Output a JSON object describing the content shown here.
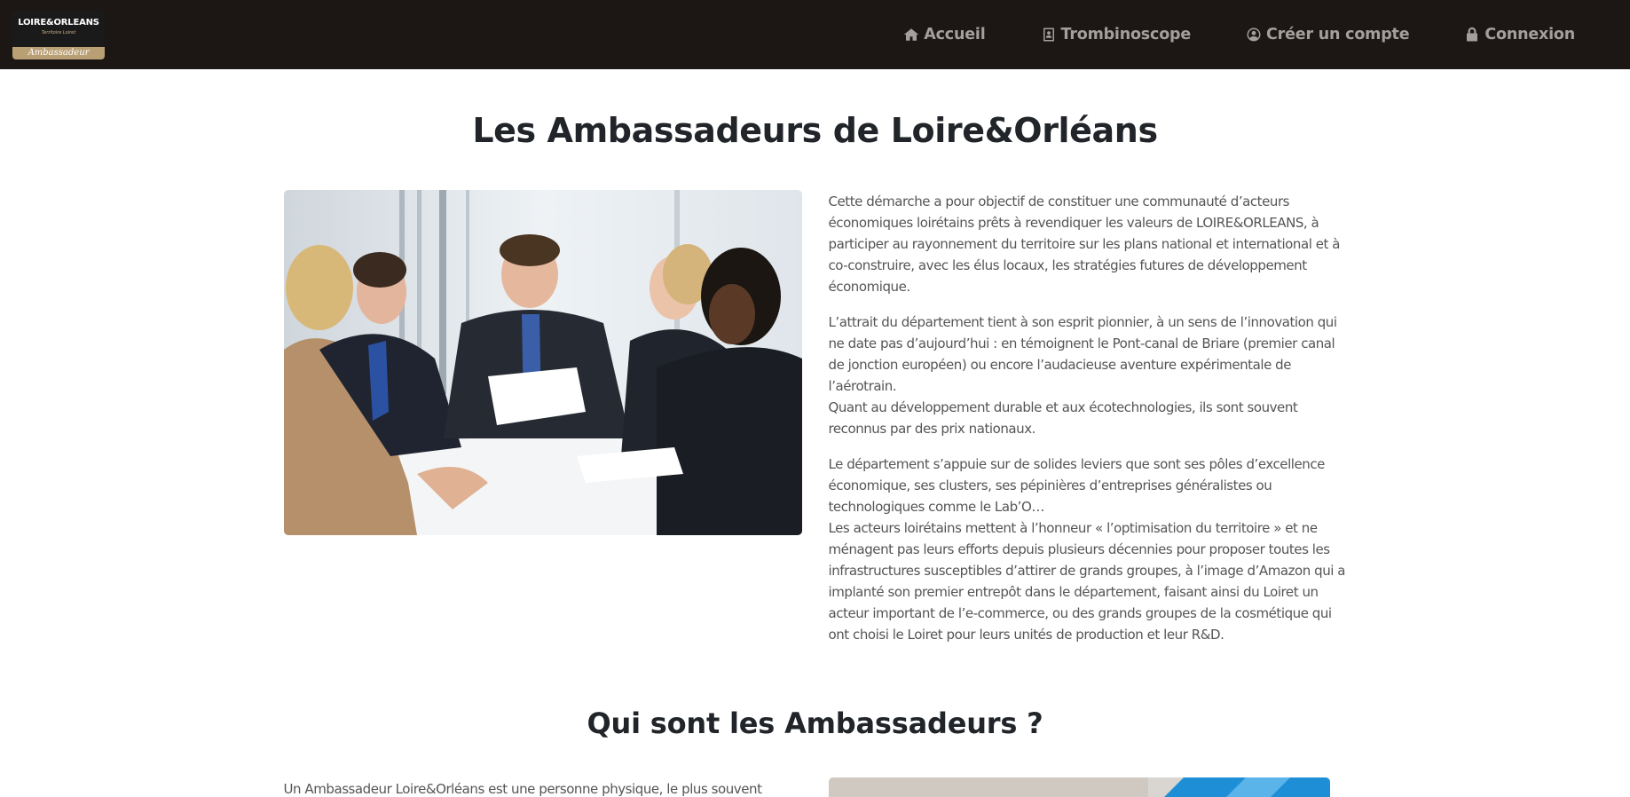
{
  "header": {
    "logo_line1": "LOIRE&ORLEANS",
    "logo_line2": "Territoire Loiret",
    "logo_line3": "Ambassadeur",
    "nav": [
      {
        "label": "Accueil",
        "icon": "home-icon"
      },
      {
        "label": "Trombinoscope",
        "icon": "contact-card-icon"
      },
      {
        "label": "Créer un compte",
        "icon": "user-circle-icon"
      },
      {
        "label": "Connexion",
        "icon": "lock-icon"
      }
    ]
  },
  "main": {
    "title": "Les Ambassadeurs de Loire&Orléans",
    "paragraphs": [
      "Cette démarche a pour objectif de constituer une communauté d’acteurs économiques loirétains prêts à revendiquer les valeurs de LOIRE&ORLEANS, à participer au rayonnement du territoire sur les plans national et international et à co-construire, avec les élus locaux, les stratégies futures de développement économique.",
      "L’attrait du département tient à son esprit pionnier, à un sens de l’innovation qui ne date pas d’aujourd’hui : en témoignent le Pont-canal de Briare (premier canal de jonction européen) ou encore l’audacieuse aventure expérimentale de l’aérotrain.",
      "Quant au développement durable et aux écotechnologies, ils sont souvent reconnus par des prix nationaux.",
      "Le département s’appuie sur de solides leviers que sont ses pôles d’excellence économique, ses clusters, ses pépinières d’entreprises généralistes ou technologiques comme le Lab’O…",
      "Les acteurs loirétains mettent à l’honneur « l’optimisation du territoire » et ne ménagent pas leurs efforts depuis plusieurs décennies pour proposer toutes les infrastructures susceptibles d’attirer de grands groupes, à l’image d’Amazon qui a implanté son premier entrepôt dans le département, faisant ainsi du Loiret un acteur important de l’e-commerce, ou des grands groupes de la cosmétique qui ont choisi le Loiret pour leurs unités de production et leur R&D."
    ],
    "section2_title": "Qui sont les Ambassadeurs ?",
    "section2_text": "Un Ambassadeur Loire&Orléans est une personne physique, le plus souvent"
  },
  "colors": {
    "navbar_bg": "#1c1714",
    "nav_text": "#a29f9c",
    "logo_gold": "#b99f74"
  }
}
